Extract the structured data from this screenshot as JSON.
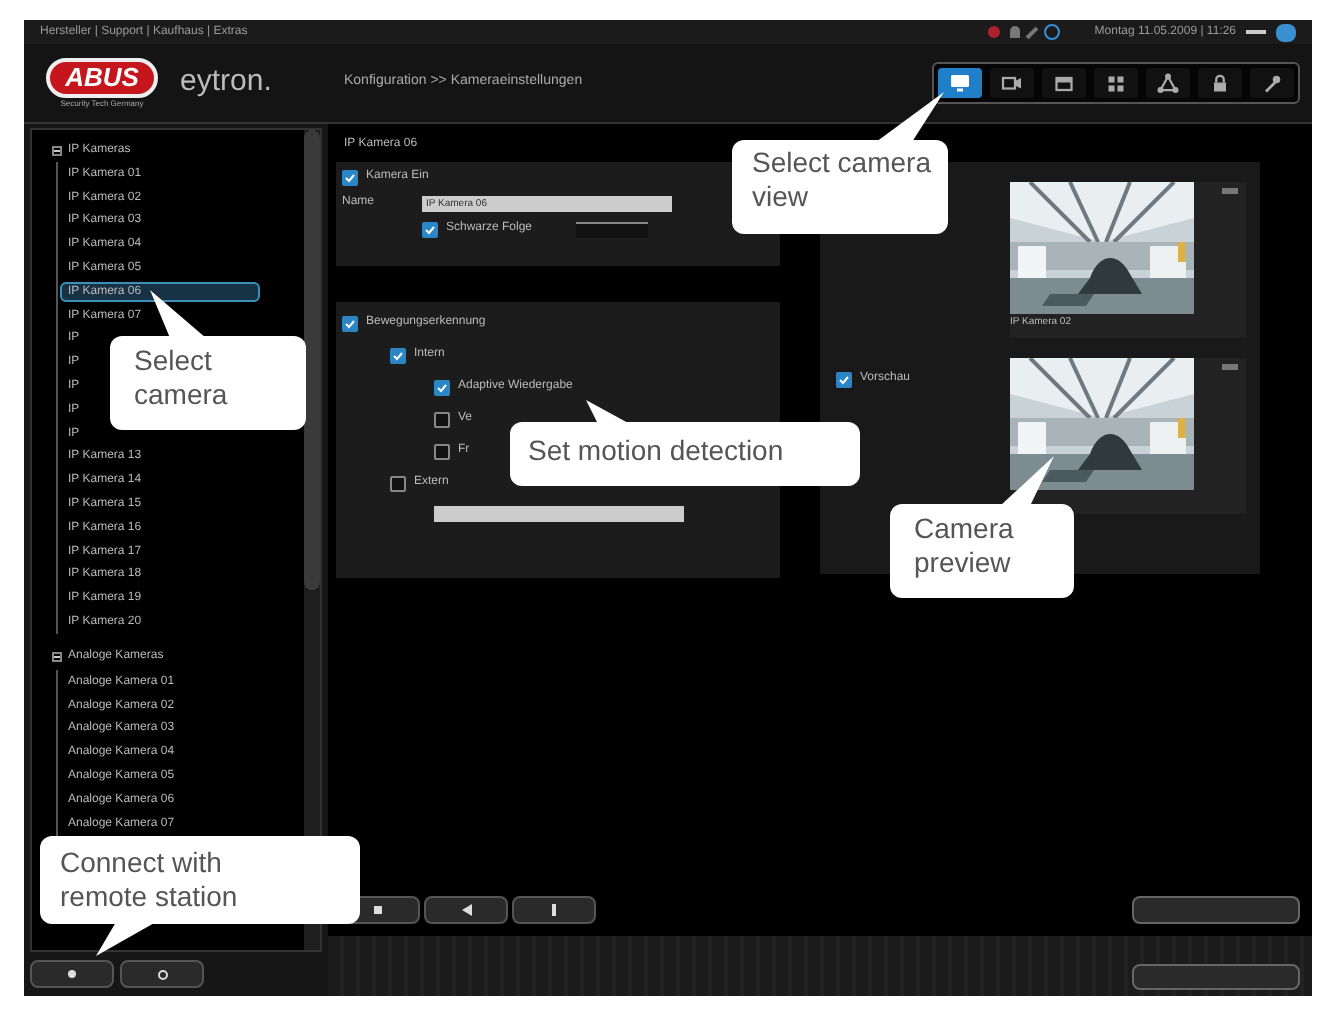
{
  "top_bar": {
    "links": "Hersteller | Support | Kaufhaus | Extras",
    "datetime": "Montag 11.05.2009 | 11:26"
  },
  "header": {
    "brand": "ABUS",
    "tagline": "Security Tech Germany",
    "product": "eytron.",
    "breadcrumb": "Konfiguration >> Kameraeinstellungen"
  },
  "view_toolbar": [
    {
      "kind": "monitor",
      "selected": true
    },
    {
      "kind": "camera",
      "selected": false
    },
    {
      "kind": "box",
      "selected": false
    },
    {
      "kind": "grid",
      "selected": false
    },
    {
      "kind": "network",
      "selected": false
    },
    {
      "kind": "lock",
      "selected": false
    },
    {
      "kind": "wrench",
      "selected": false
    }
  ],
  "tree": [
    {
      "label": "IP Kameras",
      "expanded": true,
      "children": [
        {
          "label": "IP Kamera 01",
          "selected": false
        },
        {
          "label": "IP Kamera 02",
          "selected": false
        },
        {
          "label": "IP Kamera 03",
          "selected": false
        },
        {
          "label": "IP Kamera 04",
          "selected": false
        },
        {
          "label": "IP Kamera 05",
          "selected": false
        },
        {
          "label": "IP Kamera 06",
          "selected": true
        },
        {
          "label": "IP Kamera 07",
          "selected": false
        },
        {
          "label": "IP",
          "selected": false
        },
        {
          "label": "IP",
          "selected": false
        },
        {
          "label": "IP",
          "selected": false
        },
        {
          "label": "IP",
          "selected": false
        },
        {
          "label": "IP",
          "selected": false
        },
        {
          "label": "IP Kamera 13",
          "selected": false
        },
        {
          "label": "IP Kamera 14",
          "selected": false
        },
        {
          "label": "IP Kamera 15",
          "selected": false
        },
        {
          "label": "IP Kamera 16",
          "selected": false
        },
        {
          "label": "IP Kamera 17",
          "selected": false
        },
        {
          "label": "IP Kamera 18",
          "selected": false
        },
        {
          "label": "IP Kamera 19",
          "selected": false
        },
        {
          "label": "IP Kamera 20",
          "selected": false
        }
      ]
    },
    {
      "label": "Analoge Kameras",
      "expanded": true,
      "children": [
        {
          "label": "Analoge Kamera 01",
          "selected": false
        },
        {
          "label": "Analoge Kamera 02",
          "selected": false
        },
        {
          "label": "Analoge Kamera 03",
          "selected": false
        },
        {
          "label": "Analoge Kamera 04",
          "selected": false
        },
        {
          "label": "Analoge Kamera 05",
          "selected": false
        },
        {
          "label": "Analoge Kamera 06",
          "selected": false
        },
        {
          "label": "Analoge Kamera 07",
          "selected": false
        }
      ]
    }
  ],
  "camera_panel": {
    "title": "IP Kamera 06",
    "enabled": {
      "label": "Kamera Ein",
      "checked": true
    },
    "name_label": "Name",
    "name_value": "IP Kamera 06",
    "option": {
      "label": "Schwarze Folge",
      "checked": true
    }
  },
  "motion_panel": {
    "enabled": {
      "label": "Bewegungserkennung",
      "checked": true
    },
    "options": [
      {
        "label": "Intern",
        "checked": true,
        "children": [
          {
            "label": "Adaptive Wiedergabe",
            "checked": true
          },
          {
            "label": "Ve",
            "checked": false
          },
          {
            "label": "Fr",
            "checked": false
          }
        ]
      },
      {
        "label": "Extern",
        "checked": false
      }
    ]
  },
  "preview_panel": {
    "option": {
      "label": "Vorschau",
      "checked": true
    },
    "previews": [
      {
        "kind": "picture",
        "label": "IP Kamera 02"
      },
      {
        "kind": "picture"
      }
    ]
  },
  "callouts": [
    {
      "text": "Select camera"
    },
    {
      "text": "Select camera view"
    },
    {
      "text": "Set motion detection"
    },
    {
      "text": "Camera preview"
    },
    {
      "text": "Connect with remote station"
    }
  ]
}
